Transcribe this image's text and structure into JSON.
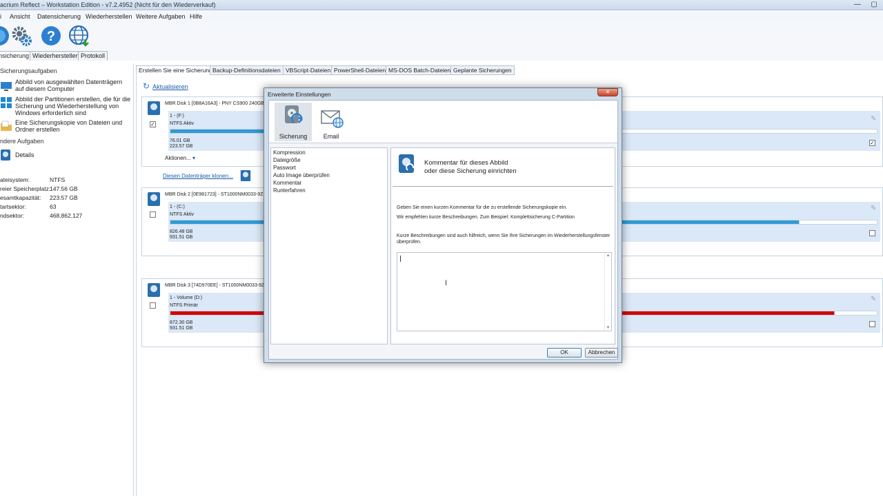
{
  "window": {
    "title": "acrium Reflect – Workstation Edition - v7.2.4952 (Nicht für den Wiederverkauf)"
  },
  "menu": [
    "i",
    "Ansicht",
    "Datensicherung",
    "Wiederherstellen",
    "Weitere Aufgaben",
    "Hilfe"
  ],
  "main_tabs": [
    "nsicherung",
    "Wiederherstellen",
    "Protokoll"
  ],
  "left": {
    "section_tasks": "Sicherungsaufgaben",
    "tasks": [
      "Abbild von ausgewählten Datenträgern auf diesem Computer",
      "Abbild der Partitionen erstellen, die für die Sicherung und Wiederherstellung von Windows erforderlich sind",
      "Eine Sicherungskopie von Dateien und Ordner erstellen"
    ],
    "section_other": "ndere Aufgaben",
    "details_label": "Details",
    "details": [
      {
        "k": "ateisystem:",
        "v": "NTFS"
      },
      {
        "k": "reier Speicherplatz:",
        "v": "147.56 GB"
      },
      {
        "k": "esamtkapazität:",
        "v": "223.57 GB"
      },
      {
        "k": "tartsektor:",
        "v": "63"
      },
      {
        "k": "ndsektor:",
        "v": "468,862,127"
      }
    ]
  },
  "sub_tabs": [
    "Erstellen Sie eine Sicherung",
    "Backup-Definitionsdateien",
    "VBScript-Dateien",
    "PowerShell-Dateien",
    "MS-DOS Batch-Dateien",
    "Geplante Sicherungen"
  ],
  "refresh_label": "Aktualisieren",
  "disks": [
    {
      "label": "MBR Disk 1 [0B8A16A3] - PNY CS900 240GB",
      "part_name": "1 - (F:)",
      "fs": "NTFS Aktiv",
      "used": "76.01 GB",
      "total": "223.57 GB",
      "used_fraction": 0.34,
      "checked": true,
      "actions": "Aktionen...",
      "clone": "Diesen Datenträger klonen..."
    },
    {
      "label": "MBR Disk 2 [0E981723] - ST1000NM0033-9Z",
      "part_name": "1 - (C:)",
      "fs": "NTFS Aktiv",
      "used": "826.48 GB",
      "total": "931.51 GB",
      "used_fraction": 0.89,
      "checked": false
    },
    {
      "label": "MBR Disk 3 [74D970EE] - ST1000NM0033-9Z",
      "part_name": "1 - Volume (D:)",
      "fs": "NTFS Primär",
      "used": "872.30 GB",
      "total": "931.51 GB",
      "used_fraction": 0.94,
      "checked": false
    }
  ],
  "dialog": {
    "title": "Erweiterte Einstellungen",
    "tools": [
      "Sicherung",
      "Email"
    ],
    "options": [
      "Kompression",
      "Dateigröße",
      "Passwort",
      "Auto Image überprüfen",
      "Kommentar",
      "Runterfahren"
    ],
    "header_line1": "Kommentar für dieses Abbild",
    "header_line2": "oder diese Sicherung einrichten",
    "text1": "Geben Sie einen kurzen Kommentar für die zu erstellende Sicherungskopie ein.",
    "text2": "Wir empfehlen kurze Beschreibungen. Zum Beispiel: Komplettsicherung C-Partition",
    "text3": "Kurze Beschreibungen sind auch hilfreich, wenn Sie Ihre Sicherungen im Wiederherstellungsfenster überprüfen.",
    "comment_value": "",
    "ok": "OK",
    "cancel": "Abbrechen"
  },
  "colors": {
    "bar_blue": "#2f9bd6",
    "bar_red": "#d40000",
    "accent_row": "#dbe8f7"
  }
}
